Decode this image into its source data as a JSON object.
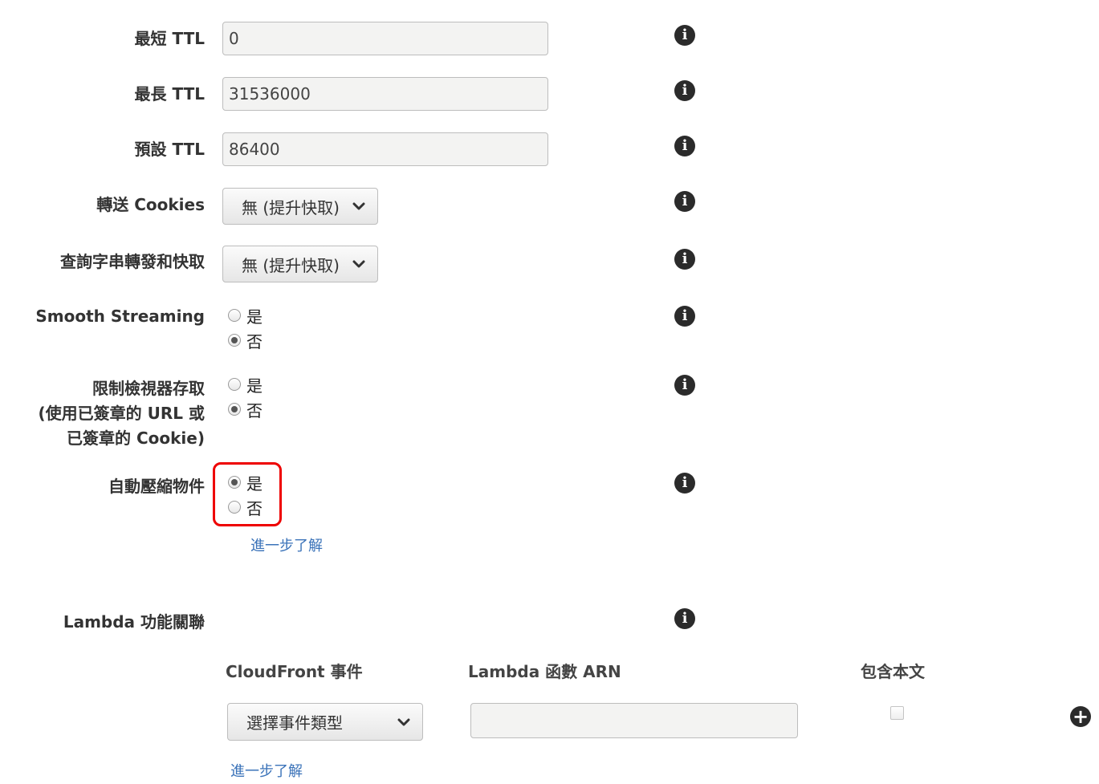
{
  "fields": {
    "min_ttl": {
      "label": "最短 TTL",
      "value": "0"
    },
    "max_ttl": {
      "label": "最長 TTL",
      "value": "31536000"
    },
    "default_ttl": {
      "label": "預設 TTL",
      "value": "86400"
    },
    "forward_cookies": {
      "label": "轉送 Cookies",
      "selected": "無 (提升快取)"
    },
    "query_string": {
      "label": "查詢字串轉發和快取",
      "selected": "無 (提升快取)"
    },
    "smooth_streaming": {
      "label": "Smooth Streaming",
      "options": [
        "是",
        "否"
      ],
      "selected": "否"
    },
    "restrict_viewer": {
      "label_lines": [
        "限制檢視器存取",
        "(使用已簽章的 URL 或",
        "已簽章的 Cookie)"
      ],
      "options": [
        "是",
        "否"
      ],
      "selected": "否"
    },
    "compress": {
      "label": "自動壓縮物件",
      "options": [
        "是",
        "否"
      ],
      "selected": "是",
      "learn_more": "進一步了解"
    }
  },
  "lambda": {
    "label": "Lambda 功能關聯",
    "columns": [
      "CloudFront 事件",
      "Lambda 函數 ARN",
      "包含本文"
    ],
    "event_placeholder": "選擇事件類型",
    "arn_value": "",
    "include_body": false,
    "learn_more": "進一步了解"
  },
  "icons": {
    "info": "info-icon",
    "add": "plus-circle-icon",
    "dropdown": "chevron-down-icon"
  },
  "colors": {
    "link": "#3b73b9",
    "highlight": "#e00000"
  }
}
